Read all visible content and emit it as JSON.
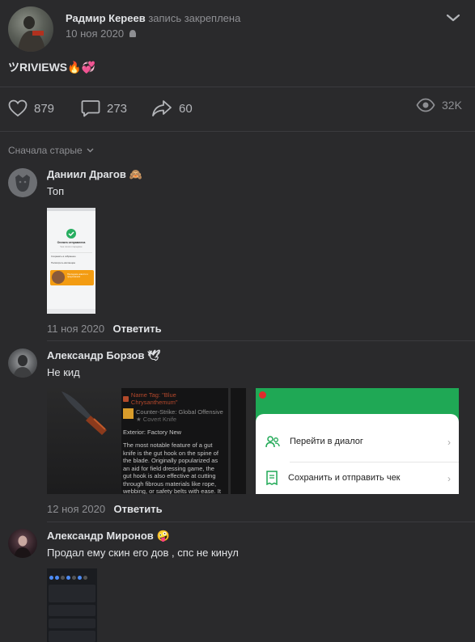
{
  "post": {
    "author": "Радмир Кереев",
    "meta": "запись закреплена",
    "date": "10 ноя 2020",
    "text": "ツRIVIEWS🔥💞",
    "likes": "879",
    "comments": "273",
    "shares": "60",
    "views": "32K"
  },
  "sort": {
    "label": "Сначала старые"
  },
  "comments": [
    {
      "author": "Даниил Драгов",
      "badge": "🙈",
      "text": "Топ",
      "date": "11 ноя 2020",
      "reply": "Ответить",
      "attachment": {
        "title": "Оплата отправлена",
        "subtitle": "Чек готов к передаче",
        "row1": "Сохранить в избранное",
        "row2": "Посмотреть квитанцию",
        "promo": "Последние новости и предложения"
      }
    },
    {
      "author": "Александр Борзов",
      "badge": "🕊",
      "text": "Не кид",
      "date": "12 ноя 2020",
      "reply": "Ответить",
      "attachment": {
        "tag": "Name Tag: \"Blue Chrysanthemum\"",
        "game": "Counter-Strike: Global Offensive",
        "kind": "★ Covert Knife",
        "exterior": "Exterior: Factory New",
        "description": "The most notable feature of a gut knife is the gut hook on the spine of the blade. Originally popularized as an aid for field dressing game, the gut hook is also effective at cutting through fibrous materials like rope, webbing, or safety belts with ease. It has been painted with black and silver metallic paints using a marbleizing medium, then candy coated. Getting lost in",
        "menu1": "Перейти в диалог",
        "menu2": "Сохранить и отправить чек"
      }
    },
    {
      "author": "Александр Миронов",
      "badge": "🤪",
      "text": "Продал ему скин его дов , спс не кинул"
    }
  ],
  "colors": {
    "bg": "#2a2a2c",
    "separator": "#3b3b3e",
    "muted": "#8e8f93",
    "accent_green": "#27ae60",
    "orange": "#f39c12"
  }
}
